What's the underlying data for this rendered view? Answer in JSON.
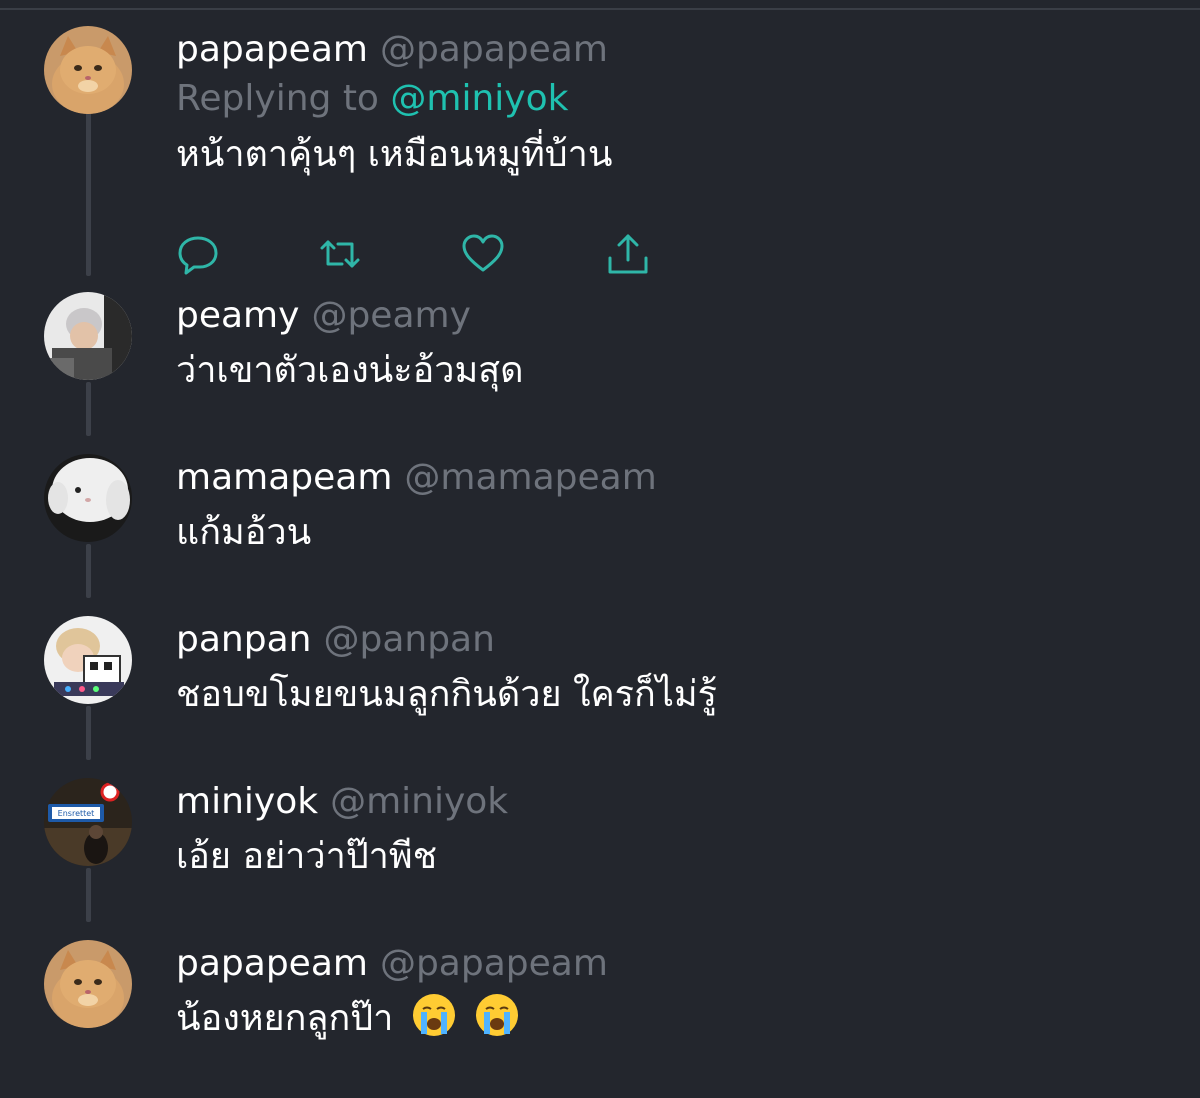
{
  "theme": {
    "background": "#23262d",
    "handle_color": "#6e737c",
    "mention_color": "#1fc1b0",
    "icon_color": "#2fb6a8"
  },
  "main_tweet": {
    "display_name": "papapeam",
    "handle": "@papapeam",
    "replying_prefix": "Replying to",
    "replying_to": "@miniyok",
    "text": "หน้าตาคุ้นๆ เหมือนหมูที่บ้าน",
    "actions": [
      "reply-icon",
      "retweet-icon",
      "like-icon",
      "share-icon"
    ]
  },
  "replies": [
    {
      "display_name": "peamy",
      "handle": "@peamy",
      "text": "ว่าเขาตัวเองน่ะอ้วมสุด",
      "avatar": "person-avatar"
    },
    {
      "display_name": "mamapeam",
      "handle": "@mamapeam",
      "text": "แก้มอ้วน",
      "avatar": "bunny-avatar"
    },
    {
      "display_name": "panpan",
      "handle": "@panpan",
      "text": "ชอบขโมยขนมลูกกินด้วย ใครก็ไม่รู้",
      "avatar": "person-avatar"
    },
    {
      "display_name": "miniyok",
      "handle": "@miniyok",
      "text": "เอ้ย อย่าว่าป๊าพีช",
      "avatar": "street-sign-avatar",
      "sign_text": "Ensrettet"
    },
    {
      "display_name": "papapeam",
      "handle": "@papapeam",
      "text": "น้องหยกลูกป๊า",
      "avatar": "cat-avatar",
      "trailing_emoji": [
        "crying-face-icon",
        "crying-face-icon"
      ]
    }
  ]
}
